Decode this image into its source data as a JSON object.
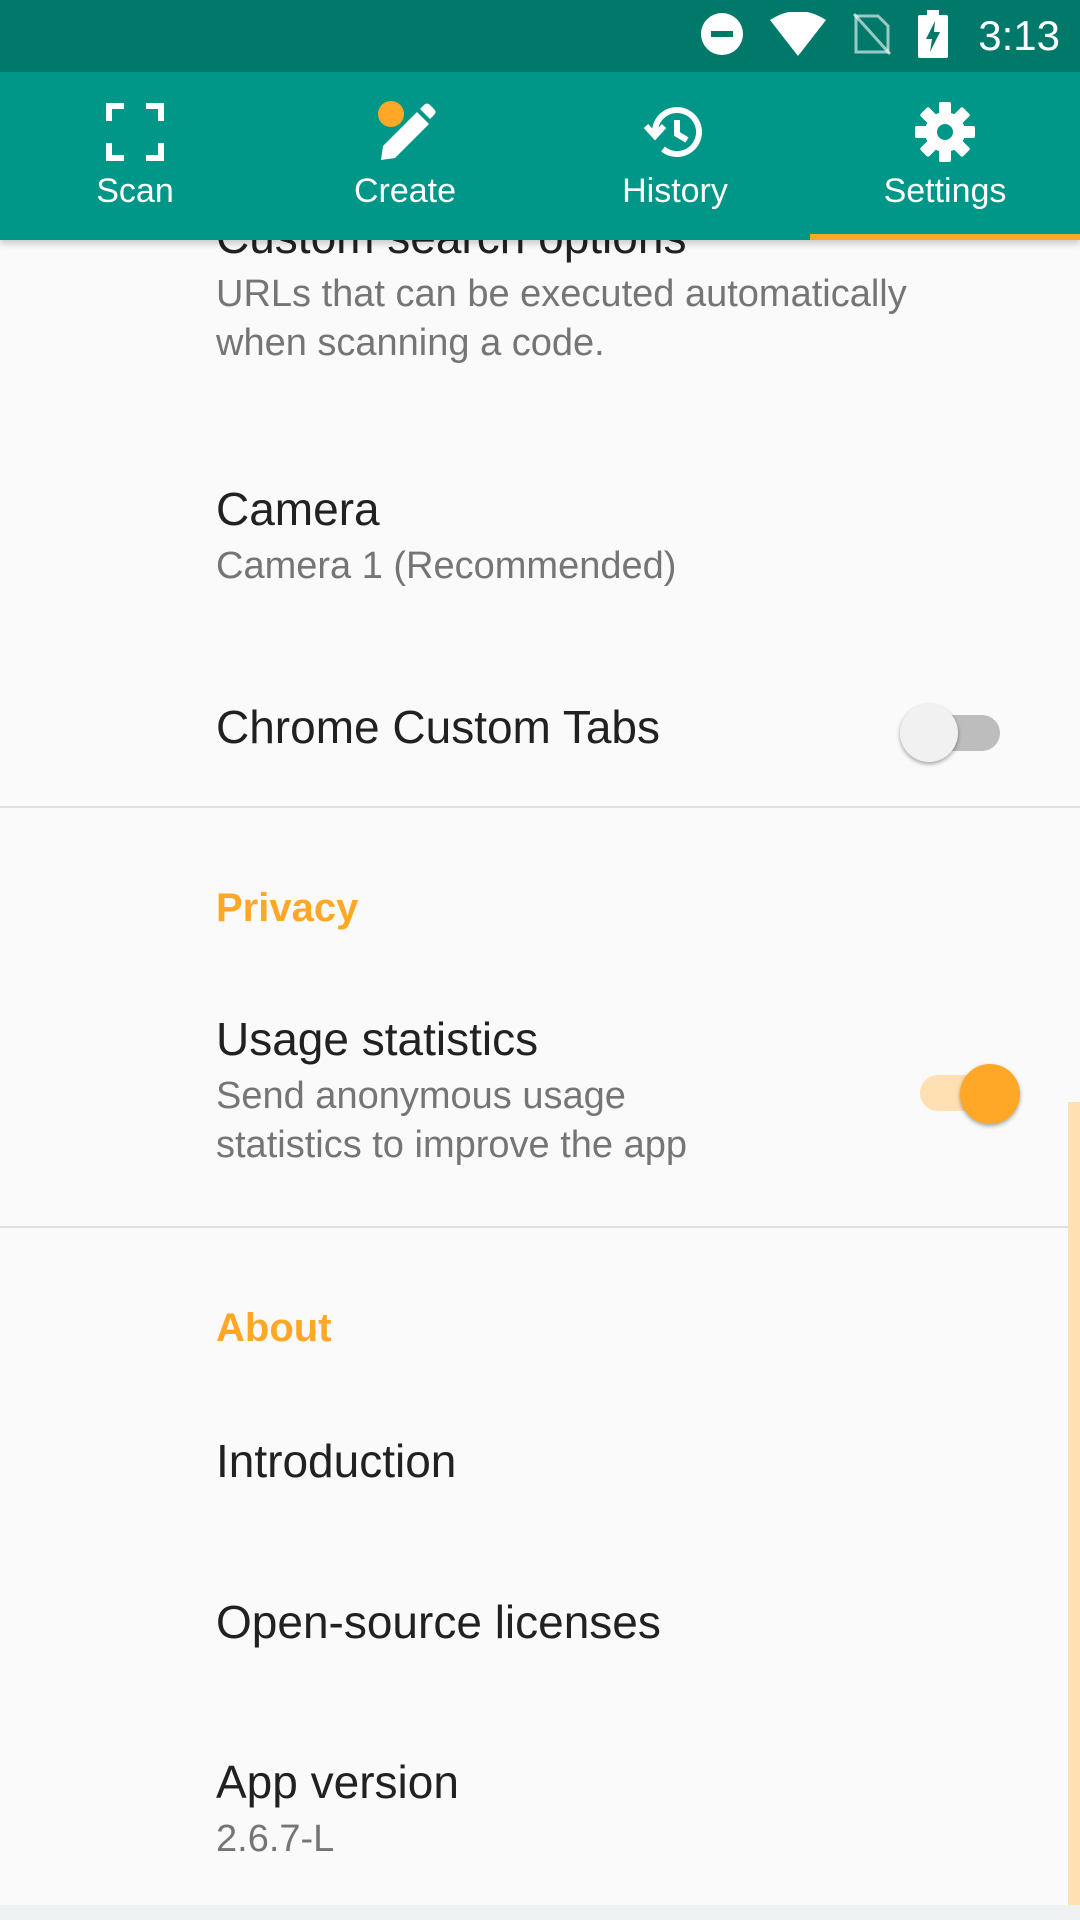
{
  "status_bar": {
    "time": "3:13",
    "icons": [
      "do-not-disturb-icon",
      "wifi-icon",
      "no-sim-icon",
      "battery-charging-icon"
    ]
  },
  "tabs": [
    {
      "label": "Scan",
      "icon": "scan-frame-icon",
      "selected": false
    },
    {
      "label": "Create",
      "icon": "pencil-icon",
      "selected": false
    },
    {
      "label": "History",
      "icon": "history-icon",
      "selected": false
    },
    {
      "label": "Settings",
      "icon": "gear-icon",
      "selected": true
    }
  ],
  "settings": {
    "custom_search": {
      "title": "Custom search options",
      "summary": "URLs that can be executed automatically when scanning a code."
    },
    "camera": {
      "title": "Camera",
      "summary": "Camera 1 (Recommended)"
    },
    "chrome_tabs": {
      "title": "Chrome Custom Tabs",
      "enabled": false
    },
    "privacy": {
      "header": "Privacy",
      "usage": {
        "title": "Usage statistics",
        "summary": "Send anonymous usage statistics to improve the app",
        "enabled": true
      }
    },
    "about": {
      "header": "About",
      "introduction": "Introduction",
      "licenses": "Open-source licenses",
      "version_title": "App version",
      "version_value": "2.6.7-L"
    }
  },
  "colors": {
    "status_bar": "#00796b",
    "toolbar": "#009688",
    "accent": "#ffa726",
    "background": "#fafafa"
  }
}
